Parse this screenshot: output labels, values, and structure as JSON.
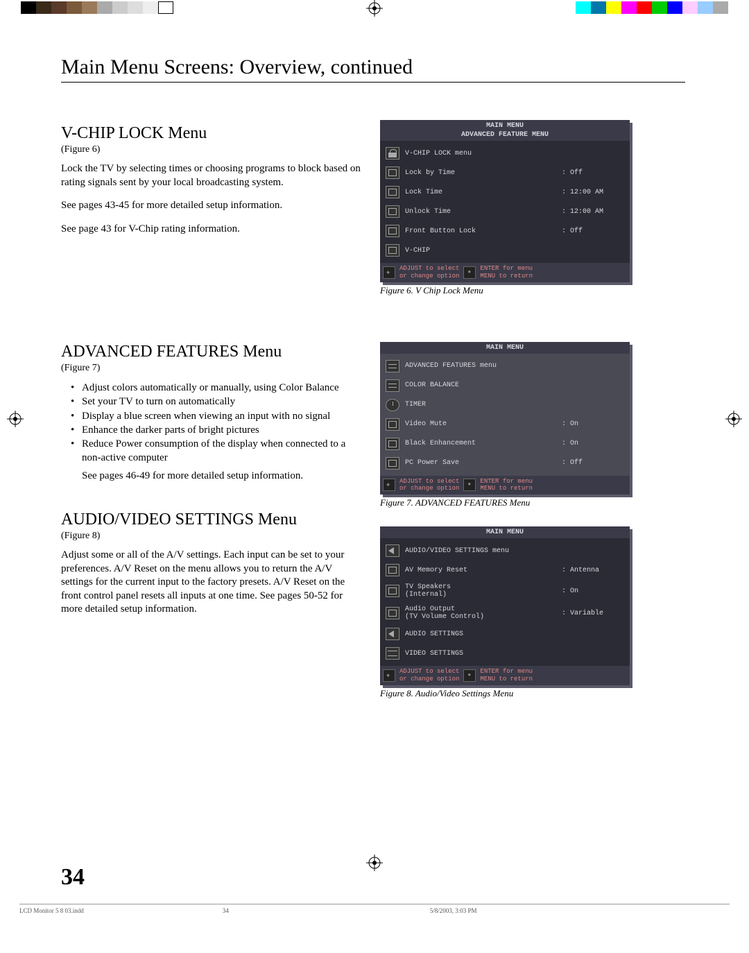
{
  "page_title": "Main Menu Screens: Overview, continued",
  "page_number": "34",
  "sections": {
    "vchip": {
      "heading": "V-CHIP LOCK Menu",
      "figref": "(Figure 6)",
      "p1": "Lock the TV by selecting times or choosing programs to block based on rating signals sent by your local broadcasting system.",
      "p2": "See pages 43-45 for more detailed setup information.",
      "p3": "See page 43 for V-Chip rating information."
    },
    "adv": {
      "heading": "ADVANCED FEATURES Menu",
      "figref": "(Figure 7)",
      "b1": "Adjust colors automatically or manually, using Color Balance",
      "b2": "Set your TV to turn on automatically",
      "b3": "Display a blue screen when viewing an input with no signal",
      "b4": "Enhance the darker parts of bright pictures",
      "b5": "Reduce Power consumption of the display when connected to a non-active computer",
      "followup": "See pages 46-49 for more detailed setup information."
    },
    "av": {
      "heading": "AUDIO/VIDEO SETTINGS Menu",
      "figref": "(Figure 8)",
      "p1": "Adjust some or all of the A/V settings.  Each input can be set to your preferences.  A/V Reset on the menu allows you to return the A/V settings for the current input to the factory presets.  A/V Reset on the front control panel resets all inputs at one time.  See pages 50-52 for more detailed setup information."
    }
  },
  "osd6": {
    "title1": "MAIN MENU",
    "title2": "ADVANCED FEATURE MENU",
    "rows": [
      {
        "icon": "padlock",
        "label": "V-CHIP LOCK menu",
        "val": ""
      },
      {
        "icon": "box",
        "label": "Lock by Time",
        "val": ": Off"
      },
      {
        "icon": "box",
        "label": "Lock Time",
        "val": ": 12:00 AM"
      },
      {
        "icon": "box",
        "label": "Unlock Time",
        "val": ": 12:00 AM"
      },
      {
        "icon": "box",
        "label": "Front Button Lock",
        "val": ": Off"
      },
      {
        "icon": "box",
        "label": "V-CHIP",
        "val": ""
      }
    ],
    "caption": "Figure 6.  V Chip Lock Menu"
  },
  "osd7": {
    "title1": "MAIN MENU",
    "rows": [
      {
        "icon": "dashes",
        "label": "ADVANCED FEATURES menu",
        "val": ""
      },
      {
        "icon": "dashes",
        "label": "COLOR BALANCE",
        "val": ""
      },
      {
        "icon": "clock",
        "label": "TIMER",
        "val": ""
      },
      {
        "icon": "box",
        "label": "Video Mute",
        "val": ": On"
      },
      {
        "icon": "box",
        "label": "Black Enhancement",
        "val": ": On"
      },
      {
        "icon": "box",
        "label": "PC Power Save",
        "val": ": Off"
      }
    ],
    "caption": "Figure 7.  ADVANCED FEATURES Menu"
  },
  "osd8": {
    "title1": "MAIN MENU",
    "rows": [
      {
        "icon": "speaker",
        "label": "AUDIO/VIDEO SETTINGS menu",
        "val": ""
      },
      {
        "icon": "box",
        "label": "AV Memory Reset",
        "val": ": Antenna"
      },
      {
        "icon": "box",
        "label": "TV Speakers\n(Internal)",
        "val": ": On"
      },
      {
        "icon": "box",
        "label": "Audio Output\n(TV Volume Control)",
        "val": ": Variable"
      },
      {
        "icon": "speaker",
        "label": "AUDIO SETTINGS",
        "val": ""
      },
      {
        "icon": "sliders",
        "label": "VIDEO SETTINGS",
        "val": ""
      }
    ],
    "caption": "Figure 8.  Audio/Video Settings Menu"
  },
  "hints": {
    "l1": "ADJUST to select",
    "l2": "or change option",
    "r1": "ENTER for menu",
    "r2": "MENU to return"
  },
  "footer": {
    "file": "LCD Monitor 5 8 03.indd",
    "pg": "34",
    "ts": "5/8/2003, 3:03 PM"
  }
}
